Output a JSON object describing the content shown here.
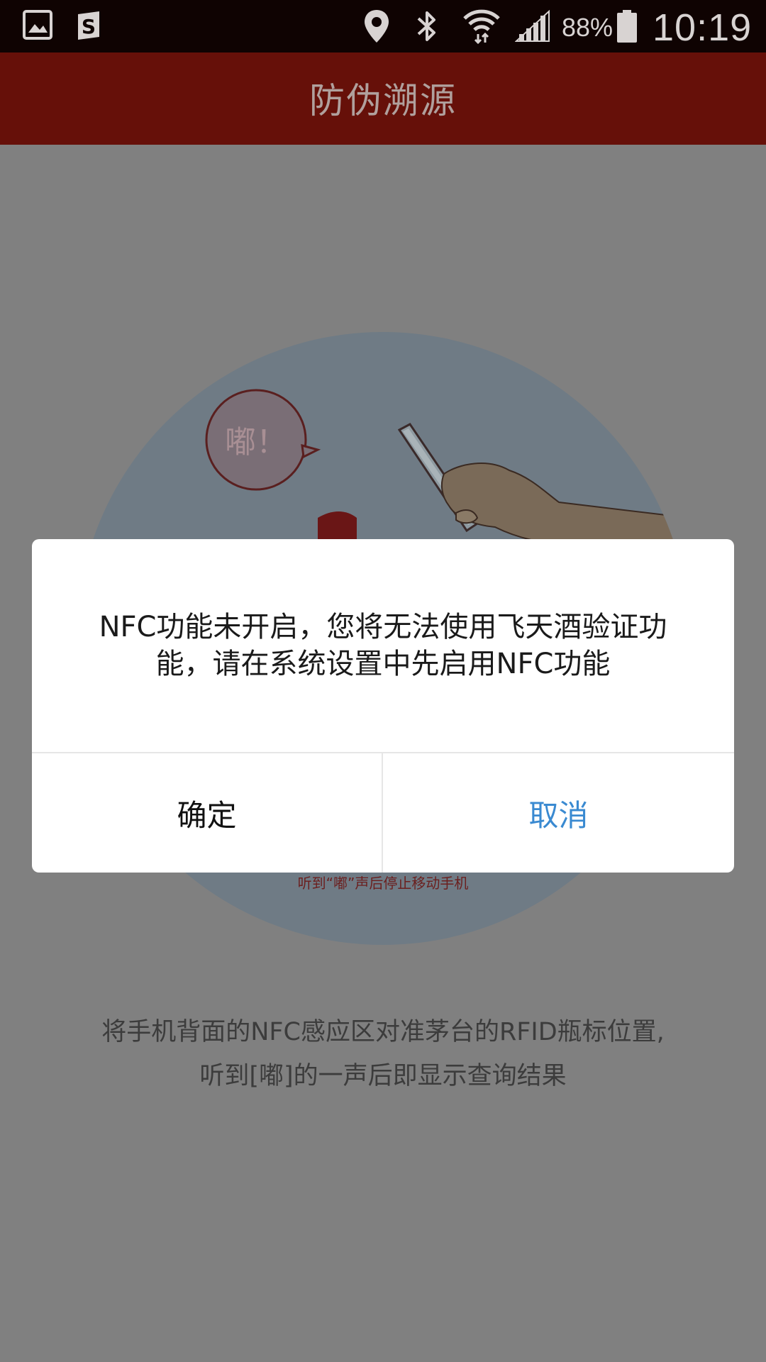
{
  "status_bar": {
    "battery_percent": "88%",
    "time": "10:19",
    "icons": [
      "gallery-icon",
      "s-app-icon",
      "location-icon",
      "bluetooth-icon",
      "wifi-icon",
      "signal-icon",
      "battery-icon"
    ]
  },
  "header": {
    "title": "防伪溯源"
  },
  "illustration": {
    "bubble_text": "嘟！",
    "caption": "听到“嘟”声后停止移动手机"
  },
  "instruction": {
    "line1": "将手机背面的NFC感应区对准茅台的RFID瓶标位置,",
    "line2": "听到[嘟]的一声后即显示查询结果"
  },
  "dialog": {
    "message_line1": "NFC功能未开启，您将无法使用飞天酒验证功",
    "message_line2": "能，请在系统设置中先启用NFC功能",
    "confirm_label": "确定",
    "cancel_label": "取消"
  },
  "colors": {
    "header_bg": "#661009",
    "status_bar_bg": "#0f0302",
    "overlay_bg": "#808080",
    "cancel_accent": "#3a8ad1"
  }
}
